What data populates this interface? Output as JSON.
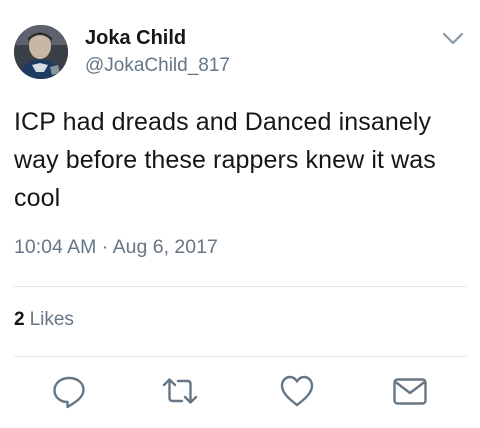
{
  "tweet": {
    "author": {
      "display_name": "Joka Child",
      "handle": "@JokaChild_817"
    },
    "text": "ICP had dreads and Danced insanely way before these rappers knew it was cool",
    "timestamp": "10:04 AM · Aug 6, 2017",
    "likes": {
      "count": "2",
      "label": "Likes"
    }
  },
  "icons": {
    "menu": "chevron-down-icon",
    "reply": "reply-icon",
    "retweet": "retweet-icon",
    "like": "heart-icon",
    "message": "envelope-icon"
  },
  "colors": {
    "text": "#14171a",
    "secondary": "#657786",
    "divider": "#e1e8ed",
    "icon": "#657786"
  }
}
